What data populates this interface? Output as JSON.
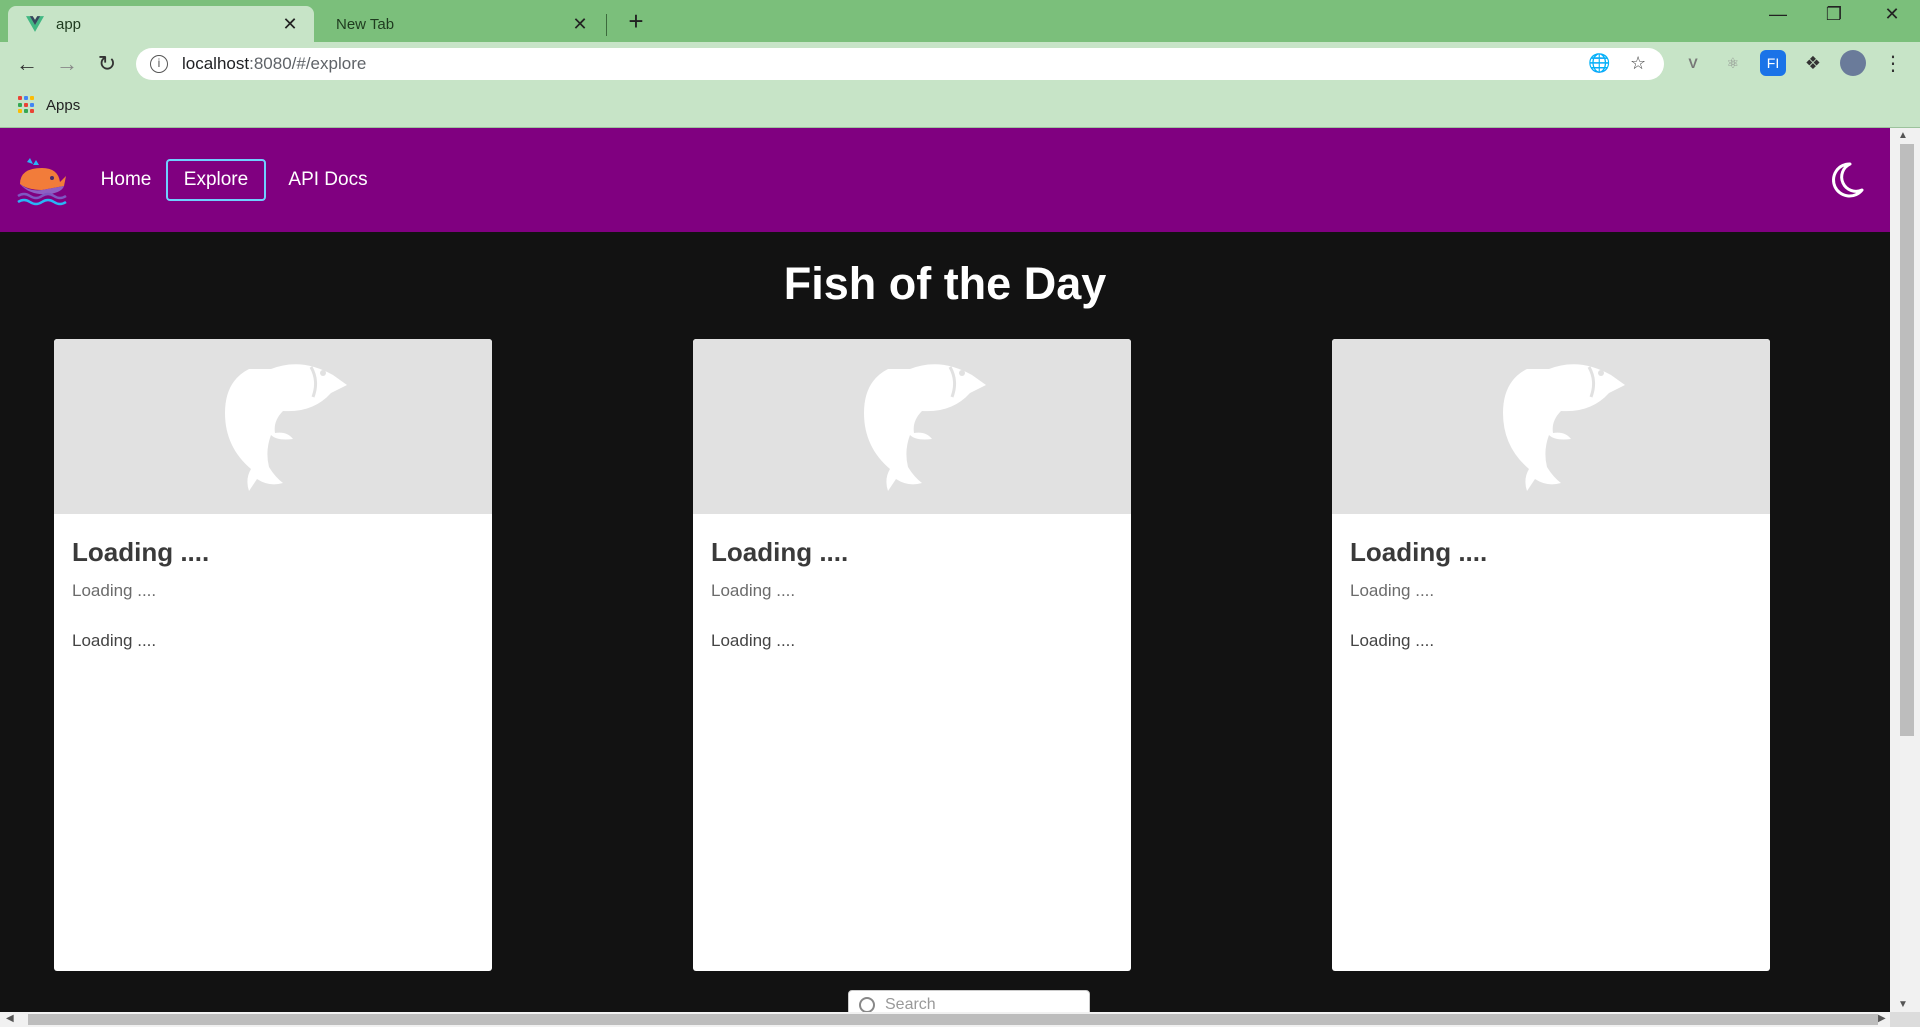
{
  "browser": {
    "tabs": [
      {
        "title": "app",
        "icon": "vue-logo-icon",
        "active": true
      },
      {
        "title": "New Tab",
        "icon": "",
        "active": false
      }
    ],
    "close_glyph": "✕",
    "new_tab_glyph": "+",
    "address": {
      "host": "localhost",
      "path": ":8080/#/explore"
    },
    "bookmarks": {
      "apps_label": "Apps"
    },
    "colors": {
      "tabbar": "#7bbf7b",
      "toolbar": "#c7e4c7"
    }
  },
  "appbar": {
    "nav": [
      {
        "label": "Home",
        "active": false
      },
      {
        "label": "Explore",
        "active": true
      },
      {
        "label": "API Docs",
        "active": false
      }
    ],
    "color": "#800080",
    "theme_toggle_icon": "moon-icon"
  },
  "page": {
    "heading": "Fish of the Day",
    "cards": [
      {
        "title": "Loading ....",
        "subtitle": "Loading ....",
        "body": "Loading ....",
        "image_icon": "fish-icon"
      },
      {
        "title": "Loading ....",
        "subtitle": "Loading ....",
        "body": "Loading ....",
        "image_icon": "fish-icon"
      },
      {
        "title": "Loading ....",
        "subtitle": "Loading ....",
        "body": "Loading ...."
      }
    ],
    "search": {
      "placeholder": "Search"
    }
  }
}
